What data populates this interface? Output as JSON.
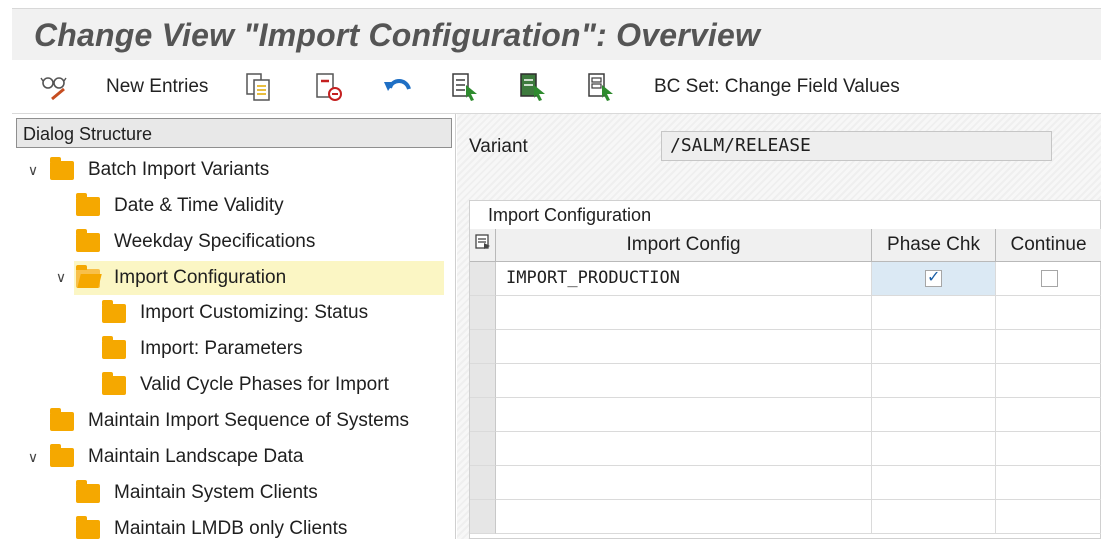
{
  "title": "Change View \"Import Configuration\": Overview",
  "toolbar": {
    "new_entries": "New Entries",
    "bc_set": "BC Set: Change Field Values",
    "icons": [
      "glasses-pencil-icon",
      "copy-icon",
      "delete-icon",
      "undo-icon",
      "select-all-icon",
      "select-block-icon",
      "deselect-all-icon"
    ]
  },
  "dialog_structure": {
    "header": "Dialog Structure",
    "items": [
      {
        "label": "Batch Import Variants"
      },
      {
        "label": "Date & Time Validity"
      },
      {
        "label": "Weekday Specifications"
      },
      {
        "label": "Import Configuration"
      },
      {
        "label": "Import Customizing: Status"
      },
      {
        "label": "Import: Parameters"
      },
      {
        "label": "Valid Cycle Phases for Import"
      },
      {
        "label": "Maintain Import Sequence of Systems"
      },
      {
        "label": "Maintain Landscape Data"
      },
      {
        "label": "Maintain System Clients"
      },
      {
        "label": "Maintain LMDB only Clients"
      }
    ]
  },
  "variant": {
    "label": "Variant",
    "value": "/SALM/RELEASE"
  },
  "table": {
    "title": "Import Configuration",
    "columns": [
      "Import Config",
      "Phase Chk",
      "Continue"
    ],
    "rows": [
      {
        "import_config": "IMPORT_PRODUCTION",
        "phase_chk": true,
        "continue": false
      }
    ]
  },
  "colors": {
    "folder": "#f5a800",
    "selected_tree_item": "#fbf6c4",
    "highlighted_cell": "#dbe9f4"
  }
}
